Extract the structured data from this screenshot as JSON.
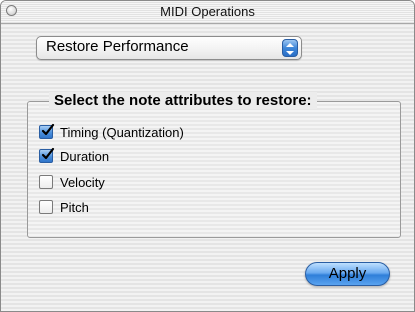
{
  "window": {
    "title": "MIDI Operations"
  },
  "operation_popup": {
    "selected": "Restore Performance",
    "arrows_icon": "up-down-arrows-icon"
  },
  "attributes_group": {
    "title": "Select the note attributes to restore:",
    "options": [
      {
        "label": "Timing (Quantization)",
        "checked": true
      },
      {
        "label": "Duration",
        "checked": true
      },
      {
        "label": "Velocity",
        "checked": false
      },
      {
        "label": "Pitch",
        "checked": false
      }
    ]
  },
  "buttons": {
    "apply_label": "Apply"
  },
  "colors": {
    "accent": "#3e86d8",
    "window_background": "#ececec"
  }
}
